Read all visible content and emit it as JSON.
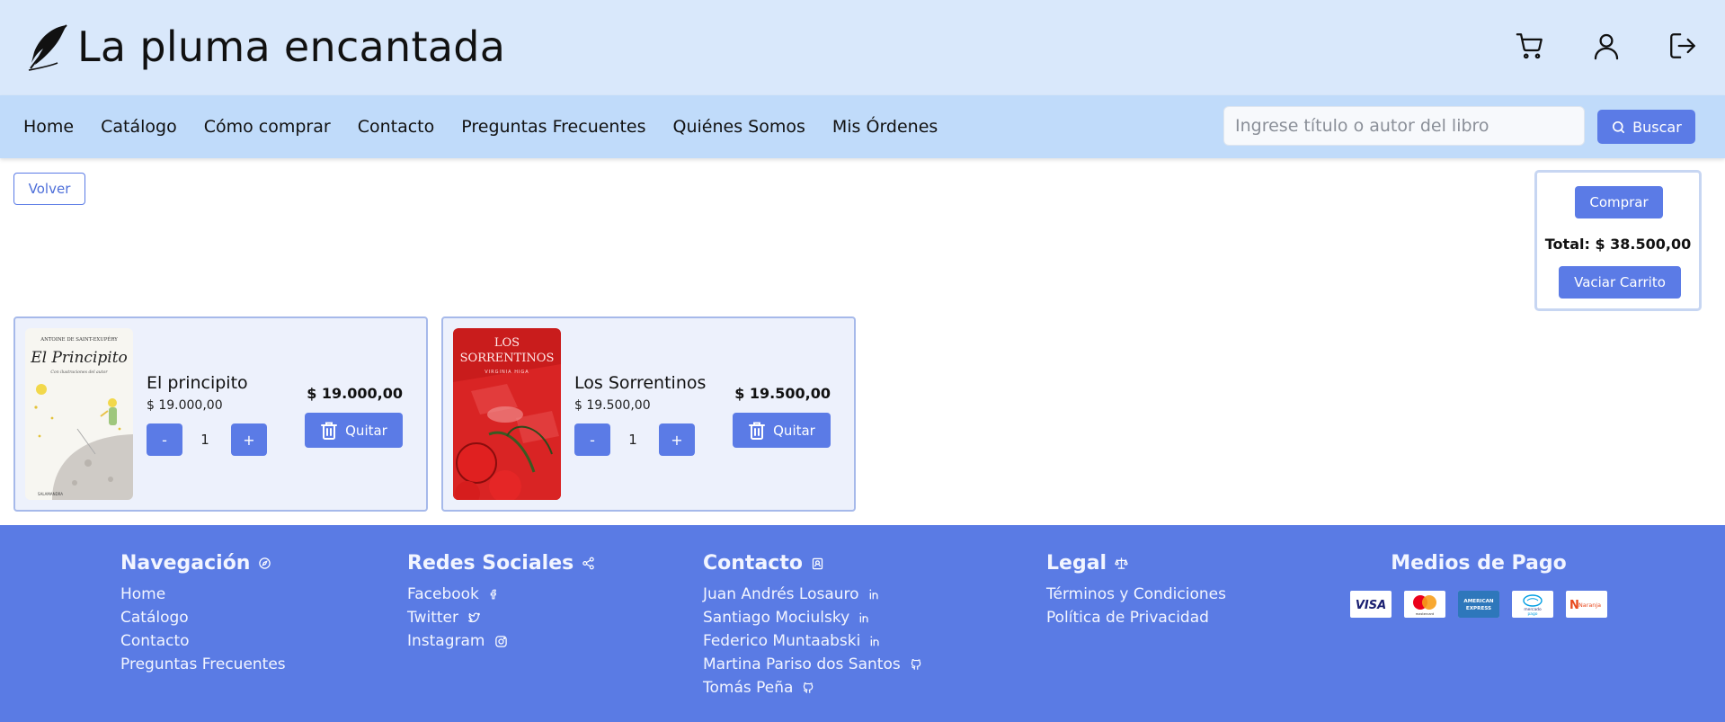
{
  "header": {
    "brand": "La pluma encantada",
    "icons": [
      "cart-icon",
      "user-icon",
      "logout-icon"
    ]
  },
  "nav": {
    "links": [
      "Home",
      "Catálogo",
      "Cómo comprar",
      "Contacto",
      "Preguntas Frecuentes",
      "Quiénes Somos",
      "Mis Órdenes"
    ],
    "search_placeholder": "Ingrese título o autor del libro",
    "search_label": "Buscar"
  },
  "main": {
    "back_label": "Volver",
    "summary": {
      "buy_label": "Comprar",
      "total_text": "Total: $ 38.500,00",
      "empty_label": "Vaciar Carrito"
    },
    "items": [
      {
        "title": "El principito",
        "price": "$ 19.000,00",
        "quantity": "1",
        "line_total": "$ 19.000,00",
        "minus": "-",
        "plus": "+",
        "remove_label": "Quitar",
        "cover": {
          "author": "ANTOINE DE SAINT-EXUPÉRY",
          "title": "El Principito",
          "subtitle": "Con ilustraciones del autor",
          "publisher": "SALAMANDRA"
        }
      },
      {
        "title": "Los Sorrentinos",
        "price": "$ 19.500,00",
        "quantity": "1",
        "line_total": "$ 19.500,00",
        "minus": "-",
        "plus": "+",
        "remove_label": "Quitar",
        "cover": {
          "title_line1": "LOS",
          "title_line2": "SORRENTINOS",
          "author": "VIRGINIA HIGA"
        }
      }
    ]
  },
  "footer": {
    "navigation": {
      "title": "Navegación",
      "links": [
        "Home",
        "Catálogo",
        "Contacto",
        "Preguntas Frecuentes"
      ]
    },
    "social": {
      "title": "Redes Sociales",
      "links": [
        "Facebook",
        "Twitter",
        "Instagram"
      ]
    },
    "contact": {
      "title": "Contacto",
      "people": [
        "Juan Andrés Losauro",
        "Santiago Mociulsky",
        "Federico Muntaabski",
        "Martina Pariso dos Santos",
        "Tomás Peña"
      ]
    },
    "legal": {
      "title": "Legal",
      "links": [
        "Términos y Condiciones",
        "Política de Privacidad"
      ]
    },
    "payment": {
      "title": "Medios de Pago",
      "methods": {
        "visa": "VISA",
        "mastercard": "mastercard",
        "amex_line1": "AMERICAN",
        "amex_line2": "EXPRESS",
        "mercadopago_line1": "mercado",
        "mercadopago_line2": "pago",
        "naranja": "Naranja"
      }
    }
  },
  "colors": {
    "header_bg": "#d9e8fb",
    "nav_bg": "#c0dbfa",
    "accent": "#5b7be6",
    "card_bg": "#edf1fc",
    "footer_bg": "#5a7be4"
  }
}
